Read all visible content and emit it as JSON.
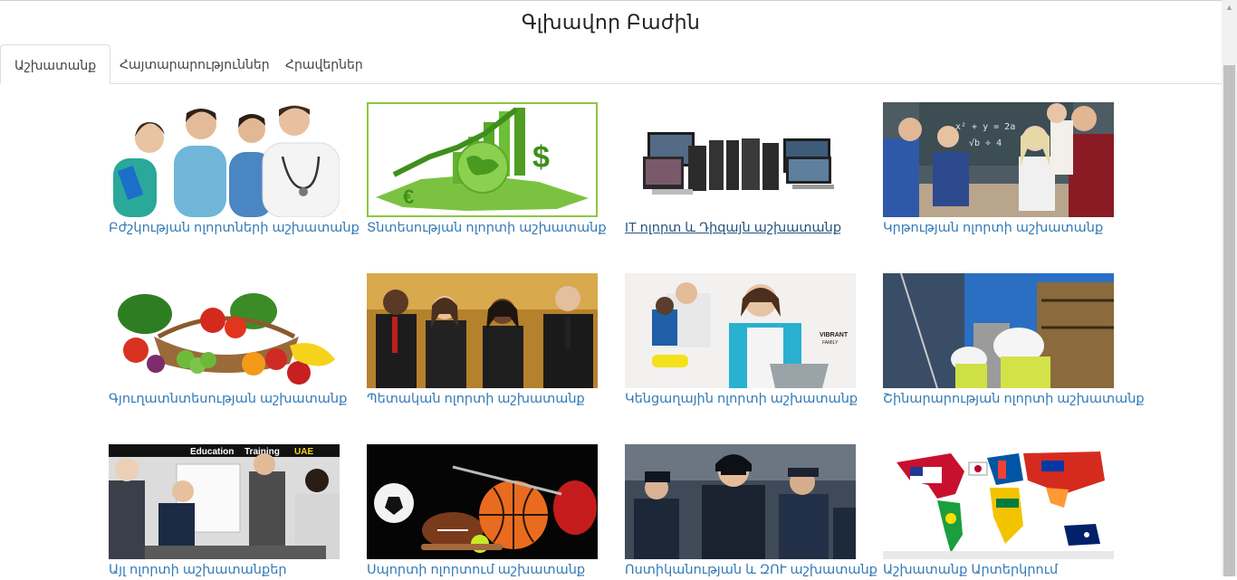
{
  "page": {
    "title": "Գլխավոր Բաժին"
  },
  "tabs": [
    {
      "label": "Աշխատանք",
      "active": true
    },
    {
      "label": "Հայտարարություններ",
      "active": false
    },
    {
      "label": "Հրավերներ",
      "active": false
    }
  ],
  "tiles": [
    {
      "caption": "Բժշկության ոլորտների աշխատանք",
      "icon": "medical-staff-image"
    },
    {
      "caption": "Տնտեսության ոլորտի աշխատանք",
      "icon": "economy-globe-image"
    },
    {
      "caption": "IT ոլորտ և Դիզայն աշխատանք",
      "icon": "computers-image"
    },
    {
      "caption": "Կրթության ոլորտի աշխատանք",
      "icon": "classroom-image"
    },
    {
      "caption": "Գյուղատնտեսության աշխատանք",
      "icon": "vegetables-basket-image"
    },
    {
      "caption": "Պետական ոլորտի աշխատանք",
      "icon": "business-people-image"
    },
    {
      "caption": "Կենցաղային ոլորտի աշխատանք",
      "icon": "cleaning-woman-image"
    },
    {
      "caption": "Շինարարության ոլորտի աշխատանք",
      "icon": "construction-workers-image"
    },
    {
      "caption": "Այլ ոլորտի աշխատանքեր",
      "icon": "training-meeting-image",
      "overlay": [
        "Education",
        "Training",
        "UAE"
      ]
    },
    {
      "caption": "Սպորտի ոլորտում աշխատանք",
      "icon": "sports-balls-image"
    },
    {
      "caption": "Ոստիկանության և ԶՈՒ աշխատանք",
      "icon": "police-officers-image"
    },
    {
      "caption": "Աշխատանք Արտերկրում",
      "icon": "world-flags-map-image"
    }
  ],
  "watermark": [
    "VIBRANT",
    "FAMILY"
  ]
}
